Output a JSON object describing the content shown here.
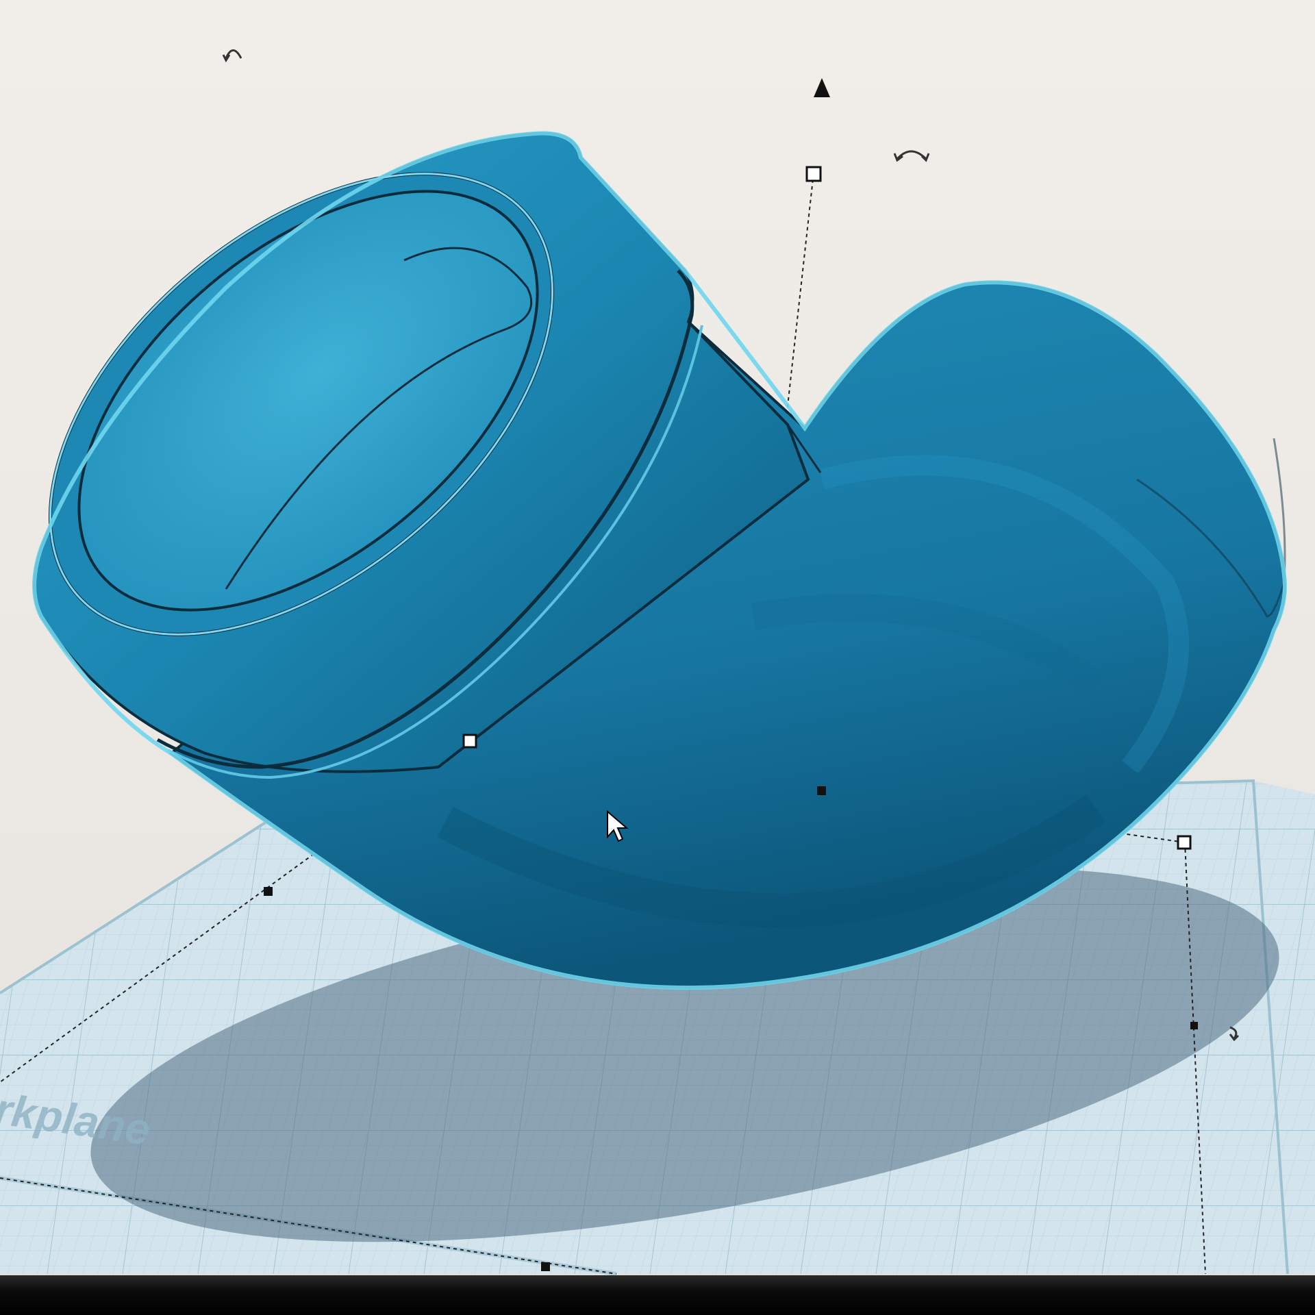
{
  "workplane": {
    "label": "Workplane",
    "visible_label": "rkplane"
  },
  "colors": {
    "shape_main": "#1d87b0",
    "shape_light": "#3aa7cf",
    "shape_dark": "#0f5f82",
    "selection_outline": "#6fd6ee",
    "workplane_fill": "#cfe2ea",
    "workplane_grid": "#a9c8d6",
    "shadow": "#4f6f86"
  },
  "icons": {
    "rotate_top_left": "rotate-arc-icon",
    "rotate_top_right": "rotate-arc-icon",
    "rotate_right": "rotate-arc-icon",
    "lift_arrow": "cone-arrow-icon",
    "cursor": "mouse-pointer-icon"
  }
}
